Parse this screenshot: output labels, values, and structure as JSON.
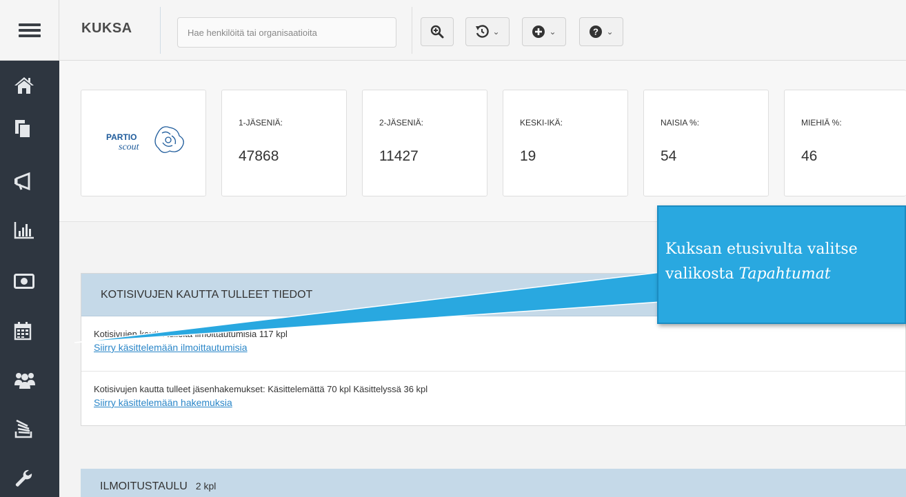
{
  "header": {
    "brand": "KUKSA",
    "search_placeholder": "Hae henkilöitä tai organisaatioita",
    "tools": [
      {
        "icon": "search-plus-icon"
      },
      {
        "icon": "history-icon",
        "has_dropdown": true
      },
      {
        "icon": "plus-circle-icon",
        "has_dropdown": true
      },
      {
        "icon": "question-circle-icon",
        "has_dropdown": true
      }
    ]
  },
  "sidebar": {
    "items": [
      {
        "icon": "home-icon"
      },
      {
        "icon": "documents-icon"
      },
      {
        "icon": "megaphone-icon"
      },
      {
        "icon": "bar-chart-icon"
      },
      {
        "icon": "money-icon"
      },
      {
        "icon": "calendar-icon"
      },
      {
        "icon": "users-icon"
      },
      {
        "icon": "courses-icon"
      },
      {
        "icon": "wrench-icon"
      }
    ]
  },
  "logo": {
    "line1": "PARTIO",
    "line2": "scout"
  },
  "stats": [
    {
      "label": "1-JÄSENIÄ:",
      "value": "47868"
    },
    {
      "label": "2-JÄSENIÄ:",
      "value": "11427"
    },
    {
      "label": "KESKI-IKÄ:",
      "value": "19"
    },
    {
      "label": "NAISIA %:",
      "value": "54"
    },
    {
      "label": "MIEHIÄ %:",
      "value": "46"
    }
  ],
  "homepage_panel": {
    "title": "KOTISIVUJEN KAUTTA TULLEET TIEDOT",
    "rows": [
      {
        "text": "Kotisivujen kautta tulleita ilmoittautumisia 117 kpl",
        "link": "Siirry käsittelemään ilmoittautumisia"
      },
      {
        "text": "Kotisivujen kautta tulleet jäsenhakemukset: Käsittelemättä 70 kpl Käsittelyssä 36 kpl",
        "link": "Siirry käsittelemään hakemuksia"
      }
    ]
  },
  "notice_board": {
    "title": "ILMOITUSTAULU",
    "count": "2 kpl"
  },
  "callout": {
    "line1": "Kuksan etusivulta valitse",
    "line2_prefix": "valikosta ",
    "line2_emphasis": "Tapahtumat"
  },
  "colors": {
    "sidebar": "#2e3640",
    "panel_header": "#c5d9e8",
    "link": "#2a86c8",
    "callout": "#29a8e0"
  }
}
